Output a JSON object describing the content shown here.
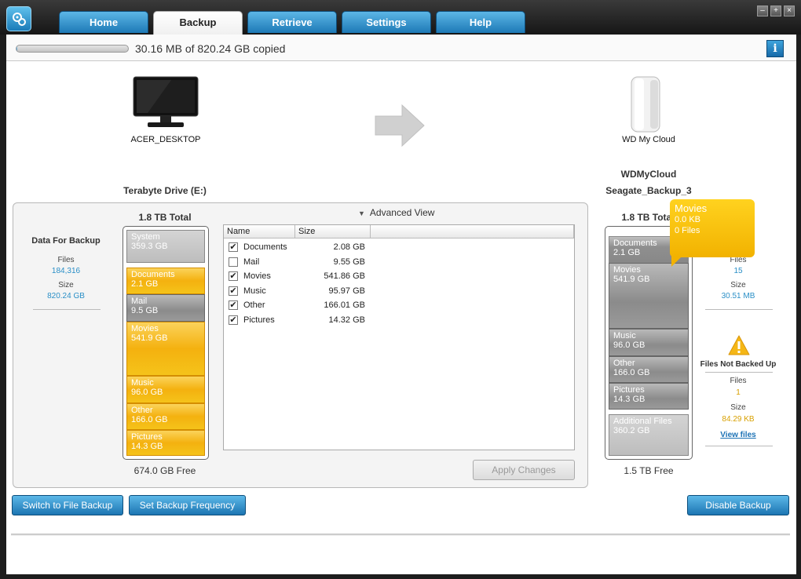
{
  "tabs": [
    {
      "label": "Home"
    },
    {
      "label": "Backup"
    },
    {
      "label": "Retrieve"
    },
    {
      "label": "Settings"
    },
    {
      "label": "Help"
    }
  ],
  "active_tab": "Backup",
  "progress": {
    "text": "30.16 MB of 820.24 GB copied",
    "fraction": 0.0001
  },
  "source": {
    "device": "ACER_DESKTOP",
    "drive": "Terabyte Drive (E:)",
    "total": "1.8 TB Total",
    "free": "674.0 GB Free"
  },
  "destination": {
    "device": "WD My Cloud",
    "name": "WDMyCloud",
    "share": "Seagate_Backup_3",
    "total": "1.8 TB Total",
    "free": "1.5 TB Free"
  },
  "data_for_backup": {
    "title": "Data For Backup",
    "files_label": "Files",
    "files": "184,316",
    "size_label": "Size",
    "size": "820.24 GB"
  },
  "backed_up": {
    "title_partial": "d Up",
    "files_label": "Files",
    "files": "15",
    "size_label": "Size",
    "size": "30.51 MB"
  },
  "not_backed_up": {
    "title": "Files Not Backed Up",
    "files_label": "Files",
    "files": "1",
    "size_label": "Size",
    "size": "84.29 KB",
    "link": "View files"
  },
  "source_segments": [
    {
      "name": "System",
      "size": "359.3 GB"
    },
    {
      "name": "Documents",
      "size": "2.1 GB"
    },
    {
      "name": "Mail",
      "size": "9.5 GB"
    },
    {
      "name": "Movies",
      "size": "541.9 GB"
    },
    {
      "name": "Music",
      "size": "96.0 GB"
    },
    {
      "name": "Other",
      "size": "166.0 GB"
    },
    {
      "name": "Pictures",
      "size": "14.3 GB"
    }
  ],
  "dest_segments": [
    {
      "name": "Documents",
      "size": "2.1 GB"
    },
    {
      "name": "Movies",
      "size": "541.9 GB"
    },
    {
      "name": "Music",
      "size": "96.0 GB"
    },
    {
      "name": "Other",
      "size": "166.0 GB"
    },
    {
      "name": "Pictures",
      "size": "14.3 GB"
    },
    {
      "name": "Additional Files",
      "size": "360.2 GB"
    }
  ],
  "advanced_view": {
    "label": "Advanced View"
  },
  "table": {
    "headers": [
      "Name",
      "Size"
    ],
    "rows": [
      {
        "name": "Documents",
        "size": "2.08 GB",
        "checked": true
      },
      {
        "name": "Mail",
        "size": "9.55 GB",
        "checked": false
      },
      {
        "name": "Movies",
        "size": "541.86 GB",
        "checked": true
      },
      {
        "name": "Music",
        "size": "95.97 GB",
        "checked": true
      },
      {
        "name": "Other",
        "size": "166.01 GB",
        "checked": true
      },
      {
        "name": "Pictures",
        "size": "14.32 GB",
        "checked": true
      }
    ]
  },
  "tooltip": {
    "title": "Movies",
    "line1": "0.0 KB",
    "line2": "0 Files"
  },
  "buttons": {
    "apply": "Apply Changes",
    "switch": "Switch to File Backup",
    "frequency": "Set Backup Frequency",
    "disable": "Disable Backup"
  },
  "info_button": "i",
  "colors": {
    "accent": "#1c75b2",
    "yellow": "#f4b10f",
    "gray": "#8b8b8b"
  }
}
